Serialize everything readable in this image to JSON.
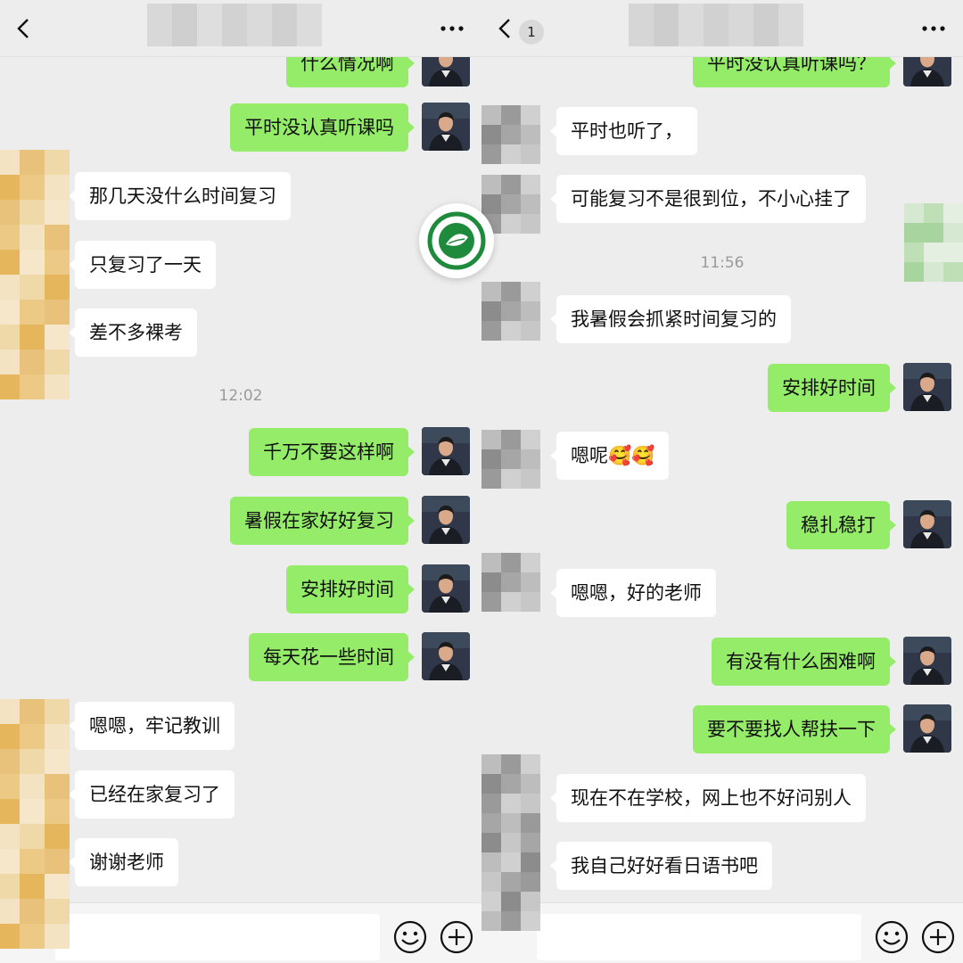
{
  "left_panel": {
    "messages": [
      {
        "side": "out",
        "text": "什么情况啊"
      },
      {
        "side": "out",
        "text": "平时没认真听课吗"
      },
      {
        "side": "in",
        "text": "那几天没什么时间复习"
      },
      {
        "side": "in",
        "text": "只复习了一天"
      },
      {
        "side": "in",
        "text": "差不多裸考"
      },
      {
        "side": "out",
        "text": "千万不要这样啊"
      },
      {
        "side": "out",
        "text": "暑假在家好好复习"
      },
      {
        "side": "out",
        "text": "安排好时间"
      },
      {
        "side": "out",
        "text": "每天花一些时间"
      },
      {
        "side": "in",
        "text": "嗯嗯，牢记教训"
      },
      {
        "side": "in",
        "text": "已经在家复习了"
      },
      {
        "side": "in",
        "text": "谢谢老师"
      }
    ],
    "timestamp": "12:02"
  },
  "right_panel": {
    "unread_count": "1",
    "messages": [
      {
        "side": "out",
        "text": "平时没认真听课吗？"
      },
      {
        "side": "in",
        "text": "平时也听了，"
      },
      {
        "side": "in",
        "text": "可能复习不是很到位，不小心挂了"
      },
      {
        "side": "in",
        "text": "我暑假会抓紧时间复习的"
      },
      {
        "side": "out",
        "text": "安排好时间"
      },
      {
        "side": "in",
        "text": "嗯呢🥰🥰"
      },
      {
        "side": "out",
        "text": "稳扎稳打"
      },
      {
        "side": "in",
        "text": "嗯嗯，好的老师"
      },
      {
        "side": "out",
        "text": "有没有什么困难啊"
      },
      {
        "side": "out",
        "text": "要不要找人帮扶一下"
      },
      {
        "side": "in",
        "text": "现在不在学校，网上也不好问别人"
      },
      {
        "side": "in",
        "text": "我自己好好看日语书吧"
      }
    ],
    "timestamp": "11:56"
  },
  "icons": {
    "back": "chevron-left-icon",
    "more": "more-dots-icon",
    "emoji": "emoji-smile-icon",
    "add": "plus-circle-icon",
    "logo": "green-leaf-seal-logo"
  },
  "colors": {
    "outgoing_bubble": "#95ec69",
    "incoming_bubble": "#ffffff",
    "background": "#ededed",
    "timestamp": "#9a9a9a"
  }
}
